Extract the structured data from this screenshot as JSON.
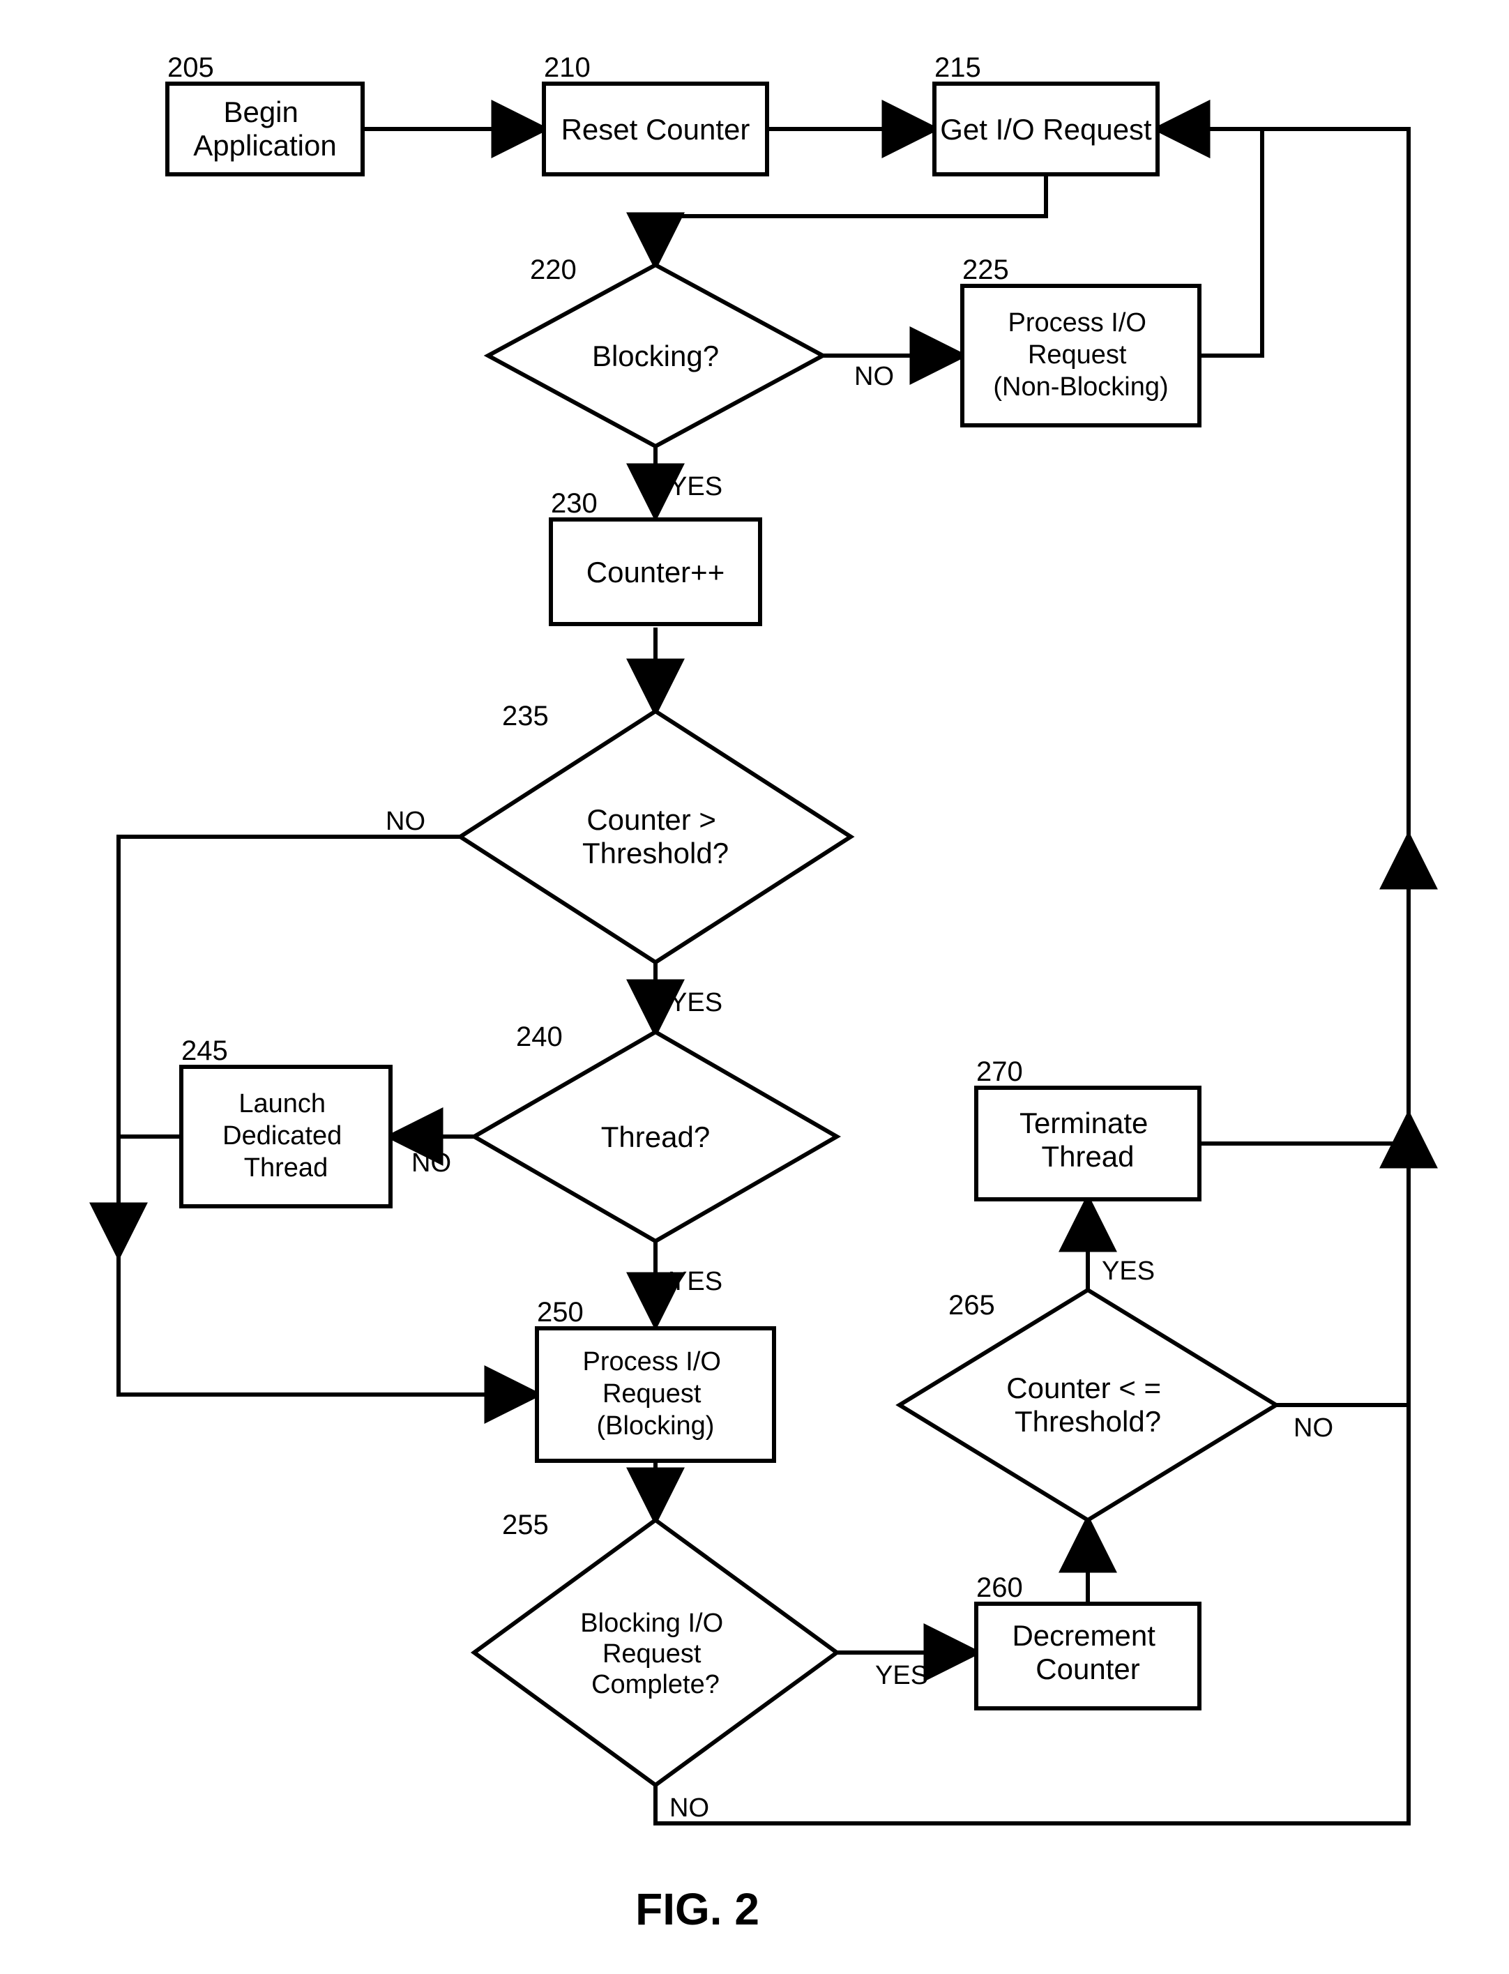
{
  "figure_title": "FIG. 2",
  "nodes": {
    "n205": {
      "num": "205",
      "text": "Begin\nApplication"
    },
    "n210": {
      "num": "210",
      "text": "Reset Counter"
    },
    "n215": {
      "num": "215",
      "text": "Get I/O Request"
    },
    "n220": {
      "num": "220",
      "text": "Blocking?"
    },
    "n225": {
      "num": "225",
      "text": "Process I/O\nRequest\n(Non-Blocking)"
    },
    "n230": {
      "num": "230",
      "text": "Counter++"
    },
    "n235": {
      "num": "235",
      "text": "Counter >\nThreshold?"
    },
    "n240": {
      "num": "240",
      "text": "Thread?"
    },
    "n245": {
      "num": "245",
      "text": "Launch\nDedicated\nThread"
    },
    "n250": {
      "num": "250",
      "text": "Process I/O\nRequest\n(Blocking)"
    },
    "n255": {
      "num": "255",
      "text": "Blocking I/O\nRequest\nComplete?"
    },
    "n260": {
      "num": "260",
      "text": "Decrement\nCounter"
    },
    "n265": {
      "num": "265",
      "text": "Counter < =\nThreshold?"
    },
    "n270": {
      "num": "270",
      "text": "Terminate\nThread"
    }
  },
  "edge_labels": {
    "yes": "YES",
    "no": "NO"
  }
}
